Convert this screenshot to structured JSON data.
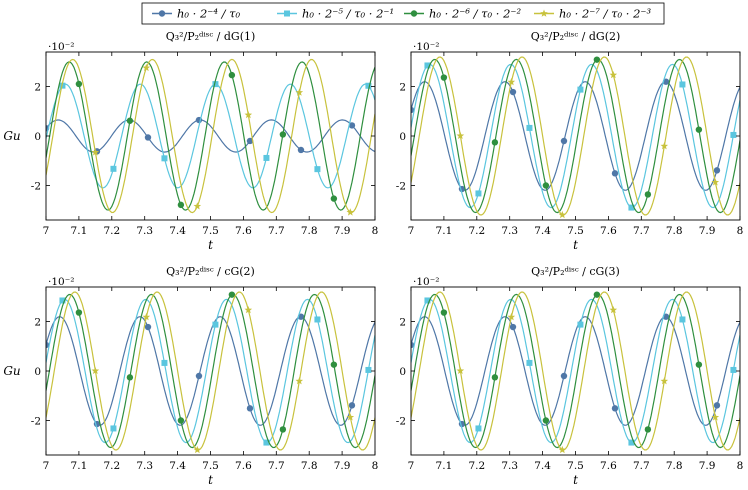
{
  "legend": [
    {
      "label": "h₀ · 2⁻⁴ / τ₀",
      "color": "#4f77a7",
      "marker": "circle"
    },
    {
      "label": "h₀ · 2⁻⁵ / τ₀ · 2⁻¹",
      "color": "#5bc6df",
      "marker": "square"
    },
    {
      "label": "h₀ · 2⁻⁶ / τ₀ · 2⁻²",
      "color": "#2f8f3f",
      "marker": "circle"
    },
    {
      "label": "h₀ · 2⁻⁷ / τ₀ · 2⁻³",
      "color": "#c8c23d",
      "marker": "star"
    }
  ],
  "chart_data": [
    {
      "type": "line",
      "title": "Q₃²/P₂ᵈⁱˢᶜ / dG(1)",
      "xlabel": "t",
      "ylabel": "Gu",
      "y_multiplier": "·10⁻²",
      "xlim": [
        7,
        8
      ],
      "ylim": [
        -3.4,
        3.4
      ],
      "xticks": [
        "7",
        "7.1",
        "7.2",
        "7.3",
        "7.4",
        "7.5",
        "7.6",
        "7.7",
        "7.8",
        "7.9",
        "8"
      ],
      "yticks": [
        "-2",
        "0",
        "2"
      ],
      "series": [
        {
          "name": "h₀ · 2⁻⁴ / τ₀",
          "amplitude": 0.65,
          "period": 0.216,
          "phase": 7.0
        },
        {
          "name": "h₀ · 2⁻⁵ / τ₀ · 2⁻¹",
          "amplitude": 2.1,
          "period": 0.228,
          "phase": 7.02
        },
        {
          "name": "h₀ · 2⁻⁶ / τ₀ · 2⁻²",
          "amplitude": 3.0,
          "period": 0.236,
          "phase": 7.03
        },
        {
          "name": "h₀ · 2⁻⁷ / τ₀ · 2⁻³",
          "amplitude": 3.1,
          "period": 0.242,
          "phase": 7.04
        }
      ]
    },
    {
      "type": "line",
      "title": "Q₃²/P₂ᵈⁱˢᶜ / dG(2)",
      "xlabel": "t",
      "ylabel": "",
      "y_multiplier": "·10⁻²",
      "xlim": [
        7,
        8
      ],
      "ylim": [
        -3.4,
        3.4
      ],
      "xticks": [
        "7",
        "7.1",
        "7.2",
        "7.3",
        "7.4",
        "7.5",
        "7.6",
        "7.7",
        "7.8",
        "7.9",
        "8"
      ],
      "yticks": [
        "-2",
        "0",
        "2"
      ],
      "series": [
        {
          "name": "h₀ · 2⁻⁴ / τ₀",
          "amplitude": 2.2,
          "period": 0.244,
          "phase": 7.0
        },
        {
          "name": "h₀ · 2⁻⁵ / τ₀ · 2⁻¹",
          "amplitude": 2.9,
          "period": 0.246,
          "phase": 7.015
        },
        {
          "name": "h₀ · 2⁻⁶ / τ₀ · 2⁻²",
          "amplitude": 3.1,
          "period": 0.248,
          "phase": 7.03
        },
        {
          "name": "h₀ · 2⁻⁷ / τ₀ · 2⁻³",
          "amplitude": 3.2,
          "period": 0.25,
          "phase": 7.045
        }
      ]
    },
    {
      "type": "line",
      "title": "Q₃²/P₂ᵈⁱˢᶜ / cG(2)",
      "xlabel": "t",
      "ylabel": "Gu",
      "y_multiplier": "·10⁻²",
      "xlim": [
        7,
        8
      ],
      "ylim": [
        -3.4,
        3.4
      ],
      "xticks": [
        "7",
        "7.1",
        "7.2",
        "7.3",
        "7.4",
        "7.5",
        "7.6",
        "7.7",
        "7.8",
        "7.9",
        "8"
      ],
      "yticks": [
        "-2",
        "0",
        "2"
      ],
      "series": [
        {
          "name": "h₀ · 2⁻⁴ / τ₀",
          "amplitude": 2.2,
          "period": 0.244,
          "phase": 7.0
        },
        {
          "name": "h₀ · 2⁻⁵ / τ₀ · 2⁻¹",
          "amplitude": 2.9,
          "period": 0.246,
          "phase": 7.015
        },
        {
          "name": "h₀ · 2⁻⁶ / τ₀ · 2⁻²",
          "amplitude": 3.1,
          "period": 0.248,
          "phase": 7.03
        },
        {
          "name": "h₀ · 2⁻⁷ / τ₀ · 2⁻³",
          "amplitude": 3.2,
          "period": 0.25,
          "phase": 7.045
        }
      ]
    },
    {
      "type": "line",
      "title": "Q₃²/P₂ᵈⁱˢᶜ / cG(3)",
      "xlabel": "t",
      "ylabel": "",
      "y_multiplier": "·10⁻²",
      "xlim": [
        7,
        8
      ],
      "ylim": [
        -3.4,
        3.4
      ],
      "xticks": [
        "7",
        "7.1",
        "7.2",
        "7.3",
        "7.4",
        "7.5",
        "7.6",
        "7.7",
        "7.8",
        "7.9",
        "8"
      ],
      "yticks": [
        "-2",
        "0",
        "2"
      ],
      "series": [
        {
          "name": "h₀ · 2⁻⁴ / τ₀",
          "amplitude": 2.2,
          "period": 0.244,
          "phase": 7.0
        },
        {
          "name": "h₀ · 2⁻⁵ / τ₀ · 2⁻¹",
          "amplitude": 2.9,
          "period": 0.246,
          "phase": 7.015
        },
        {
          "name": "h₀ · 2⁻⁶ / τ₀ · 2⁻²",
          "amplitude": 3.1,
          "period": 0.248,
          "phase": 7.03
        },
        {
          "name": "h₀ · 2⁻⁷ / τ₀ · 2⁻³",
          "amplitude": 3.2,
          "period": 0.25,
          "phase": 7.045
        }
      ]
    }
  ]
}
